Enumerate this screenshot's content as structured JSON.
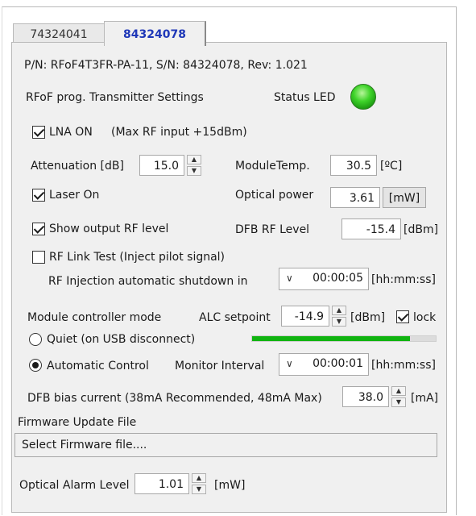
{
  "tabs": [
    {
      "label": "74324041",
      "active": false
    },
    {
      "label": "84324078",
      "active": true
    }
  ],
  "info_line": "P/N: RFoF4T3FR-PA-11,  S/N: 84324078,  Rev: 1.021",
  "settings_title": "RFoF prog. Transmitter Settings",
  "status_led": {
    "label": "Status LED",
    "color": "#3fd42a",
    "state": "on"
  },
  "lna": {
    "label": "LNA ON",
    "checked": true,
    "note": "(Max RF input +15dBm)"
  },
  "attenuation": {
    "label": "Attenuation [dB]",
    "value": "15.0"
  },
  "module_temp": {
    "label": "ModuleTemp.",
    "value": "30.5",
    "unit": "[ºC]"
  },
  "laser": {
    "label": "Laser On",
    "checked": true
  },
  "optical_power": {
    "label": "Optical power",
    "value": "3.61",
    "unit": "[mW]"
  },
  "show_rf": {
    "label": "Show output RF level",
    "checked": true
  },
  "dfb_rf_level": {
    "label": "DFB RF Level",
    "value": "-15.4",
    "unit": "[dBm]"
  },
  "rf_link_test": {
    "label": "RF Link Test (Inject pilot signal)",
    "checked": false
  },
  "rf_injection": {
    "label": "RF Injection automatic shutdown in",
    "value": "00:00:05",
    "unit": "[hh:mm:ss]"
  },
  "controller_mode": {
    "label": "Module controller mode"
  },
  "alc": {
    "label": "ALC setpoint",
    "value": "-14.9",
    "unit": "[dBm]",
    "lock_label": "lock",
    "lock_checked": true
  },
  "quiet": {
    "label": "Quiet (on USB disconnect)",
    "selected": false
  },
  "alc_level": {
    "fraction": 0.86,
    "color": "#10b410"
  },
  "automatic": {
    "label": "Automatic Control",
    "selected": true
  },
  "monitor_interval": {
    "label": "Monitor Interval",
    "value": "00:00:01",
    "unit": "[hh:mm:ss]"
  },
  "dfb_bias": {
    "label": "DFB bias current (38mA Recommended, 48mA Max)",
    "value": "38.0",
    "unit": "[mA]"
  },
  "firmware": {
    "label": "Firmware Update File",
    "button": "Select Firmware file...."
  },
  "optical_alarm": {
    "label": "Optical Alarm Level",
    "value": "1.01",
    "unit": "[mW]"
  },
  "icons": {
    "spin_up": "▲",
    "spin_down": "▼",
    "combo": "∨"
  }
}
